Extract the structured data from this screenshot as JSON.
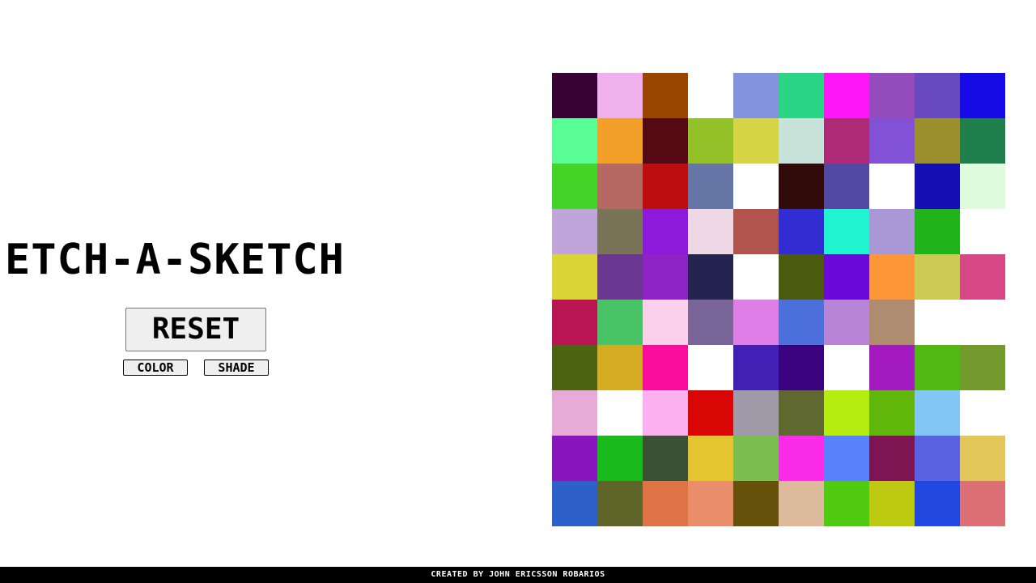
{
  "app": {
    "title": "ETCH-A-SKETCH"
  },
  "controls": {
    "reset_label": "RESET",
    "color_label": "COLOR",
    "shade_label": "SHADE"
  },
  "footer": {
    "credit": "CREATED BY JOHN ERICSSON ROBARIOS"
  },
  "grid": {
    "rows": 10,
    "columns": 10,
    "cells": [
      [
        "#360334",
        "#f0b0ee",
        "#9a4500",
        "#ffffff",
        "#8393dd",
        "#2bd585",
        "#fd16f8",
        "#944cbd",
        "#6849c0",
        "#150ae3"
      ],
      [
        "#59fe94",
        "#f3a02b",
        "#540a12",
        "#93c127",
        "#d5d545",
        "#c8e4da",
        "#ad2b76",
        "#8152d6",
        "#9b8e2c",
        "#1e7e4c"
      ],
      [
        "#44d427",
        "#b66963",
        "#bc0d10",
        "#6676a6",
        "#ffffff",
        "#300b0a",
        "#524aa2",
        "#ffffff",
        "#1410b4",
        "#dffbdd"
      ],
      [
        "#c0a5da",
        "#797358",
        "#8d1ada",
        "#eed8e6",
        "#b2544e",
        "#312dd2",
        "#1ff3d0",
        "#aa97d6",
        "#20b31a",
        "#ffffff"
      ],
      [
        "#d8d534",
        "#6a3891",
        "#8e22c4",
        "#232450",
        "#ffffff",
        "#4a5a0f",
        "#6a09da",
        "#fd9637",
        "#ccca52",
        "#d84887"
      ],
      [
        "#b91552",
        "#48c365",
        "#fad0ec",
        "#7a6599",
        "#de7ee6",
        "#4b6fdb",
        "#b784d6",
        "#af8b70",
        "#ffffff",
        "#ffffff"
      ],
      [
        "#4a6414",
        "#d3ac21",
        "#f80d9c",
        "#ffffff",
        "#4220b6",
        "#3c037e",
        "#ffffff",
        "#a31bbe",
        "#50b913",
        "#729a2c"
      ],
      [
        "#e8abd7",
        "#ffffff",
        "#fcb0ef",
        "#d90606",
        "#9f9ba9",
        "#5e682f",
        "#b5ed10",
        "#61b60c",
        "#81c6f4",
        "#ffffff"
      ],
      [
        "#8816bc",
        "#18ba1c",
        "#3a5136",
        "#e4c52f",
        "#7abf4f",
        "#fb2ce8",
        "#5a81fc",
        "#7f1452",
        "#5a62e2",
        "#e2c657"
      ],
      [
        "#2d61c9",
        "#5f6428",
        "#de7446",
        "#e98d6a",
        "#67520b",
        "#dcba9b",
        "#51ca12",
        "#bdc910",
        "#2249df",
        "#dd6f77"
      ]
    ]
  }
}
